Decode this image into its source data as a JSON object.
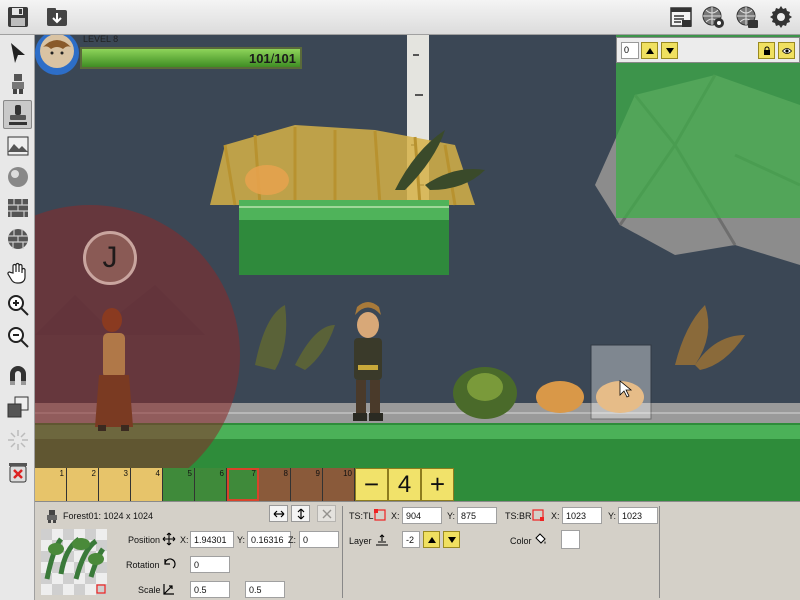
{
  "hud": {
    "level_text": "LEVEL 8",
    "health_current": "101",
    "health_separator": "/",
    "health_max": "101",
    "health_fraction": 1.0
  },
  "layer_panel": {
    "value": "0"
  },
  "bubble": {
    "letter": "J"
  },
  "tiles": [
    "1",
    "2",
    "3",
    "4",
    "5",
    "6",
    "7",
    "8",
    "9",
    "10"
  ],
  "selected_tile": "7",
  "tile_controls": {
    "minus": "−",
    "value": "4",
    "plus": "+"
  },
  "properties": {
    "texture_name": "Forest01: 1024 x 1024",
    "position_label": "Position",
    "x_label": "X:",
    "pos_x": "1.94301",
    "y_label": "Y:",
    "pos_y": "0.16316",
    "z_label": "Z:",
    "pos_z": "0",
    "rotation_label": "Rotation",
    "rotation": "0",
    "scale_label": "Scale",
    "scale_x": "0.5",
    "scale_y": "0.5",
    "ts_tl_label": "TS:TL",
    "ts_tl_x_label": "X:",
    "ts_tl_x": "904",
    "ts_tl_y_label": "Y:",
    "ts_tl_y": "875",
    "ts_br_label": "TS:BR",
    "ts_br_x_label": "X:",
    "ts_br_x": "1023",
    "ts_br_y_label": "Y:",
    "ts_br_y": "1023",
    "layer_label": "Layer",
    "layer_value": "-2",
    "color_label": "Color",
    "color_value": "#ffffff"
  }
}
